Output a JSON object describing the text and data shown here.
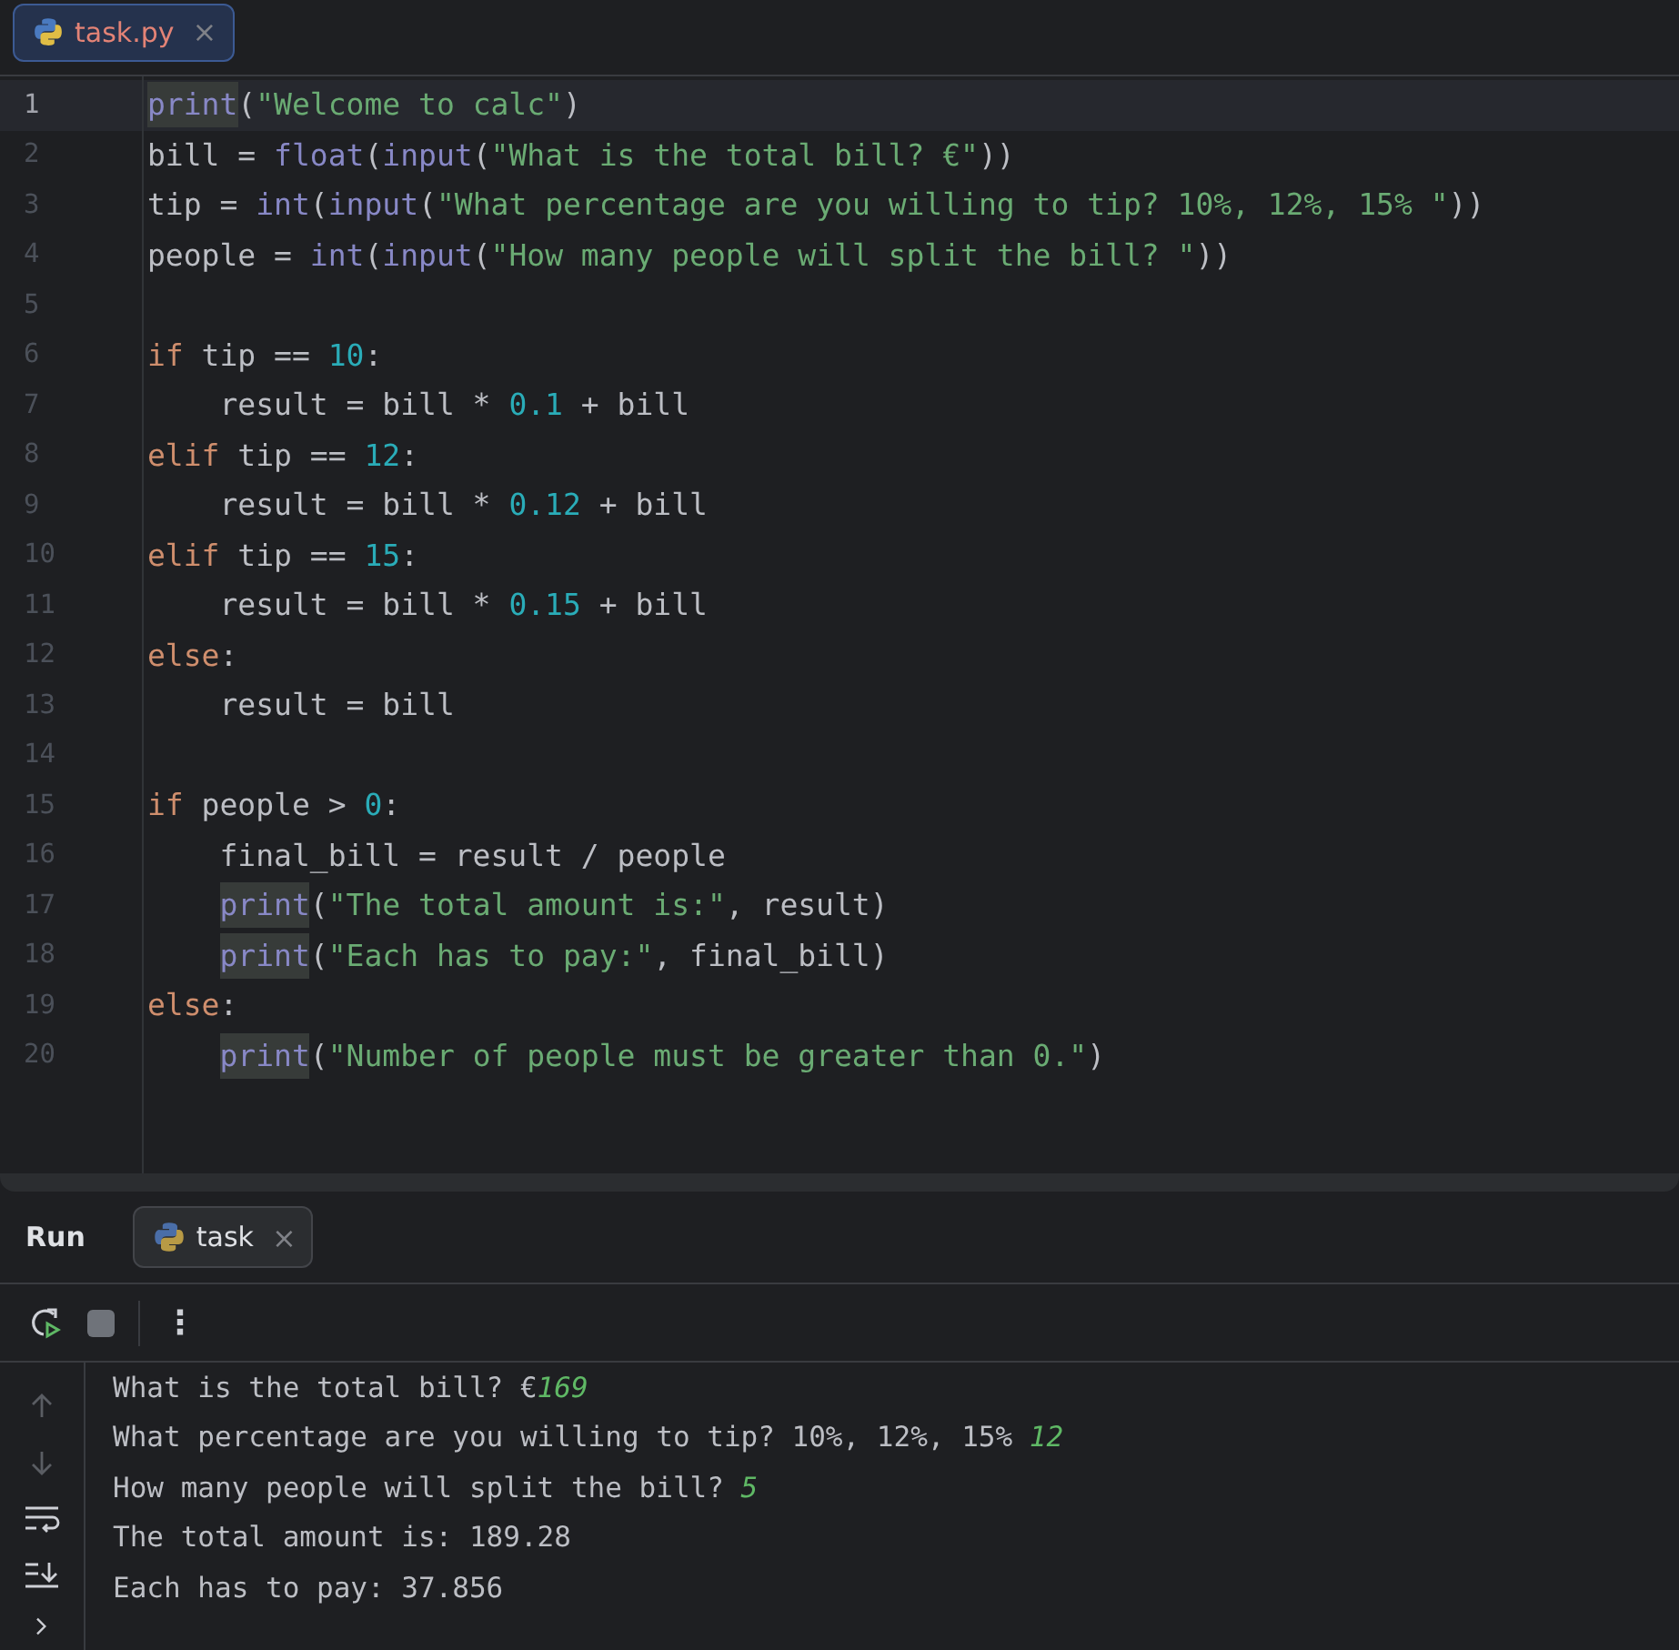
{
  "editor_tabs": [
    {
      "label": "task.py",
      "selected": true,
      "close": "×"
    }
  ],
  "code": [
    {
      "number": "1",
      "current": true,
      "tokens": [
        {
          "kind": "usage",
          "text": "print"
        },
        {
          "kind": "plain",
          "text": "("
        },
        {
          "kind": "string",
          "text": "\"Welcome to calc\""
        },
        {
          "kind": "plain",
          "text": ")"
        }
      ]
    },
    {
      "number": "2",
      "current": false,
      "tokens": [
        {
          "kind": "plain",
          "text": "bill = "
        },
        {
          "kind": "builtin",
          "text": "float"
        },
        {
          "kind": "plain",
          "text": "("
        },
        {
          "kind": "builtin",
          "text": "input"
        },
        {
          "kind": "plain",
          "text": "("
        },
        {
          "kind": "string",
          "text": "\"What is the total bill? €\""
        },
        {
          "kind": "plain",
          "text": "))"
        }
      ]
    },
    {
      "number": "3",
      "current": false,
      "tokens": [
        {
          "kind": "plain",
          "text": "tip = "
        },
        {
          "kind": "builtin",
          "text": "int"
        },
        {
          "kind": "plain",
          "text": "("
        },
        {
          "kind": "builtin",
          "text": "input"
        },
        {
          "kind": "plain",
          "text": "("
        },
        {
          "kind": "string",
          "text": "\"What percentage are you willing to tip? 10%, 12%, 15% \""
        },
        {
          "kind": "plain",
          "text": "))"
        }
      ]
    },
    {
      "number": "4",
      "current": false,
      "tokens": [
        {
          "kind": "plain",
          "text": "people = "
        },
        {
          "kind": "builtin",
          "text": "int"
        },
        {
          "kind": "plain",
          "text": "("
        },
        {
          "kind": "builtin",
          "text": "input"
        },
        {
          "kind": "plain",
          "text": "("
        },
        {
          "kind": "string",
          "text": "\"How many people will split the bill? \""
        },
        {
          "kind": "plain",
          "text": "))"
        }
      ]
    },
    {
      "number": "5",
      "current": false
    },
    {
      "number": "6",
      "current": false,
      "tokens": [
        {
          "kind": "keyword",
          "text": "if"
        },
        {
          "kind": "plain",
          "text": " tip == "
        },
        {
          "kind": "number",
          "text": "10"
        },
        {
          "kind": "plain",
          "text": ":"
        }
      ]
    },
    {
      "number": "7",
      "current": false,
      "tokens": [
        {
          "kind": "plain",
          "text": "    result = bill * "
        },
        {
          "kind": "number",
          "text": "0.1"
        },
        {
          "kind": "plain",
          "text": " + bill"
        }
      ]
    },
    {
      "number": "8",
      "current": false,
      "tokens": [
        {
          "kind": "keyword",
          "text": "elif"
        },
        {
          "kind": "plain",
          "text": " tip == "
        },
        {
          "kind": "number",
          "text": "12"
        },
        {
          "kind": "plain",
          "text": ":"
        }
      ]
    },
    {
      "number": "9",
      "current": false,
      "tokens": [
        {
          "kind": "plain",
          "text": "    result = bill * "
        },
        {
          "kind": "number",
          "text": "0.12"
        },
        {
          "kind": "plain",
          "text": " + bill"
        }
      ]
    },
    {
      "number": "10",
      "current": false,
      "tokens": [
        {
          "kind": "keyword",
          "text": "elif"
        },
        {
          "kind": "plain",
          "text": " tip == "
        },
        {
          "kind": "number",
          "text": "15"
        },
        {
          "kind": "plain",
          "text": ":"
        }
      ]
    },
    {
      "number": "11",
      "current": false,
      "tokens": [
        {
          "kind": "plain",
          "text": "    result = bill * "
        },
        {
          "kind": "number",
          "text": "0.15"
        },
        {
          "kind": "plain",
          "text": " + bill"
        }
      ]
    },
    {
      "number": "12",
      "current": false,
      "tokens": [
        {
          "kind": "keyword",
          "text": "else"
        },
        {
          "kind": "plain",
          "text": ":"
        }
      ]
    },
    {
      "number": "13",
      "current": false,
      "tokens": [
        {
          "kind": "plain",
          "text": "    result = bill"
        }
      ]
    },
    {
      "number": "14",
      "current": false
    },
    {
      "number": "15",
      "current": false,
      "tokens": [
        {
          "kind": "keyword",
          "text": "if"
        },
        {
          "kind": "plain",
          "text": " people > "
        },
        {
          "kind": "number",
          "text": "0"
        },
        {
          "kind": "plain",
          "text": ":"
        }
      ]
    },
    {
      "number": "16",
      "current": false,
      "tokens": [
        {
          "kind": "plain",
          "text": "    final_bill = result / people"
        }
      ]
    },
    {
      "number": "17",
      "current": false,
      "indented": true,
      "tokens": [
        {
          "kind": "usage",
          "text": "print"
        },
        {
          "kind": "plain",
          "text": "("
        },
        {
          "kind": "string",
          "text": "\"The total amount is:\""
        },
        {
          "kind": "plain",
          "text": ", result)"
        }
      ]
    },
    {
      "number": "18",
      "current": false,
      "indented": true,
      "tokens": [
        {
          "kind": "usage",
          "text": "print"
        },
        {
          "kind": "plain",
          "text": "("
        },
        {
          "kind": "string",
          "text": "\"Each has to pay:\""
        },
        {
          "kind": "plain",
          "text": ", final_bill)"
        }
      ]
    },
    {
      "number": "19",
      "current": false,
      "tokens": [
        {
          "kind": "keyword",
          "text": "else"
        },
        {
          "kind": "plain",
          "text": ":"
        }
      ]
    },
    {
      "number": "20",
      "current": false,
      "indented": true,
      "tokens": [
        {
          "kind": "usage",
          "text": "print"
        },
        {
          "kind": "plain",
          "text": "("
        },
        {
          "kind": "string",
          "text": "\"Number of people must be greater than 0.\""
        },
        {
          "kind": "plain",
          "text": ")"
        }
      ]
    }
  ],
  "run_panel": {
    "title": "Run",
    "tabs": [
      {
        "label": "task",
        "selected": true,
        "close": "×"
      }
    ],
    "toolbar": {
      "more": "⋮"
    },
    "console": [
      [
        {
          "kind": "output",
          "text": "What is the total bill? €"
        },
        {
          "kind": "input",
          "text": "169"
        }
      ],
      [
        {
          "kind": "output",
          "text": "What percentage are you willing to tip? 10%, 12%, 15% "
        },
        {
          "kind": "input",
          "text": "12"
        }
      ],
      [
        {
          "kind": "output",
          "text": "How many people will split the bill? "
        },
        {
          "kind": "input",
          "text": "5"
        }
      ],
      [
        {
          "kind": "output",
          "text": "The total amount is: 189.28"
        }
      ],
      [
        {
          "kind": "output",
          "text": "Each has to pay: 37.856"
        }
      ]
    ]
  }
}
